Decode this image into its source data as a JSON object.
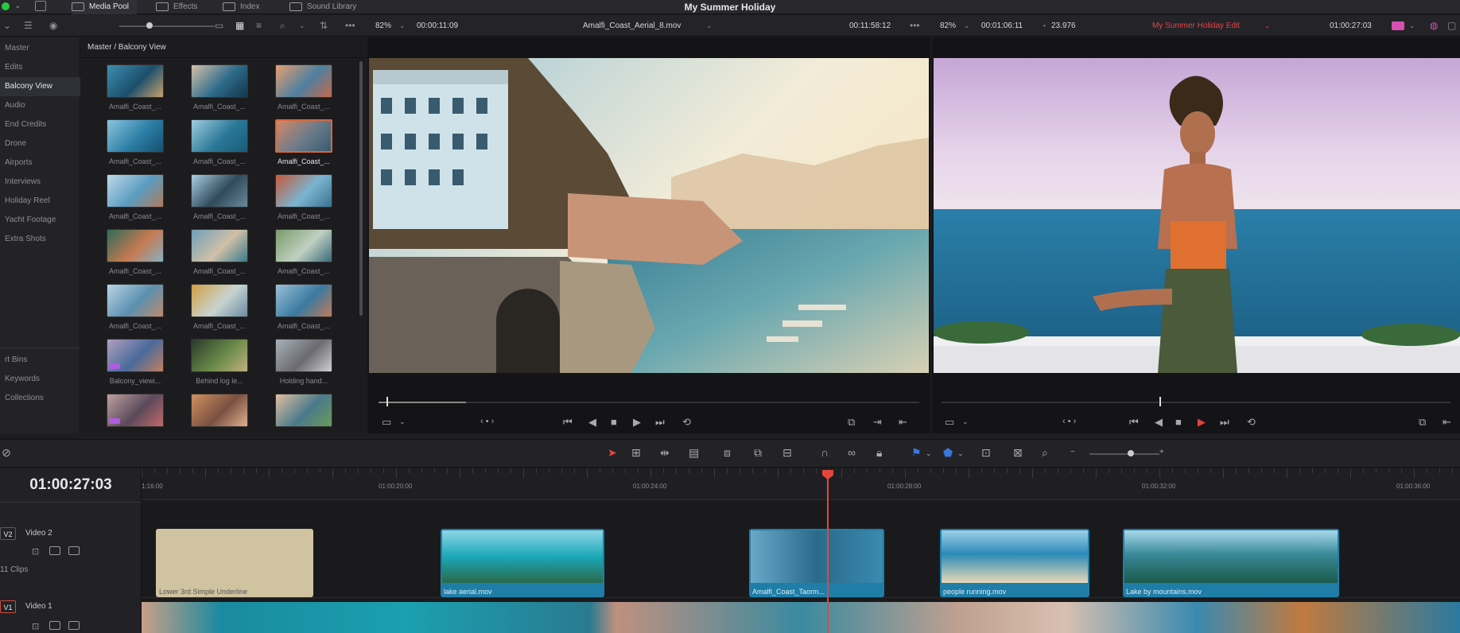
{
  "topbar": {
    "project_title": "My Summer Holiday",
    "tabs": [
      {
        "label": "Media Pool",
        "icon": "media-pool-icon",
        "active": true
      },
      {
        "label": "Effects",
        "icon": "effects-icon",
        "active": false
      },
      {
        "label": "Index",
        "icon": "index-icon",
        "active": false
      },
      {
        "label": "Sound Library",
        "icon": "sound-library-icon",
        "active": false
      }
    ]
  },
  "source_viewer": {
    "zoom": "82%",
    "timecode_in": "00:00:11:09",
    "clip_name": "Amalfi_Coast_Aerial_8.mov",
    "timecode_out": "00:11:58:12"
  },
  "timeline_viewer": {
    "zoom": "82%",
    "duration": "00:01:06:11",
    "fps": "23.976",
    "timeline_name": "My Summer Holiday Edit",
    "timecode": "01:00:27:03"
  },
  "sidebar": {
    "items": [
      "Master",
      "Edits",
      "Balcony View",
      "Audio",
      "End Credits",
      "Drone",
      "Airports",
      "Interviews",
      "Holiday Reel",
      "Yacht Footage",
      "Extra Shots"
    ],
    "selected": "Balcony View",
    "smart_bins_label": "rt Bins",
    "smart_items": [
      "Keywords",
      "Collections"
    ]
  },
  "media_pool": {
    "path": "Master / Balcony View",
    "clips": [
      {
        "label": "Amalfi_Coast_...",
        "colors": [
          "#3f8eb0",
          "#1b4f6a",
          "#c8a070"
        ]
      },
      {
        "label": "Amalfi_Coast_...",
        "colors": [
          "#d4c2a8",
          "#2e6c8a",
          "#14344c"
        ]
      },
      {
        "label": "Amalfi_Coast_...",
        "colors": [
          "#e6a070",
          "#4f7fa0",
          "#c46a4a"
        ]
      },
      {
        "label": "Amalfi_Coast_...",
        "colors": [
          "#8ac6e0",
          "#2d7ea6",
          "#145070"
        ]
      },
      {
        "label": "Amalfi_Coast_...",
        "colors": [
          "#9fcde0",
          "#2b7898",
          "#1a5a78"
        ]
      },
      {
        "label": "Amalfi_Coast_...",
        "colors": [
          "#d08a66",
          "#6a7b8a",
          "#3a5a70"
        ],
        "selected": true
      },
      {
        "label": "Amalfi_Coast_...",
        "colors": [
          "#bfd9ea",
          "#5b9cc0",
          "#b07a5a"
        ]
      },
      {
        "label": "Amalfi_Coast_...",
        "colors": [
          "#a7cfe2",
          "#304a5a",
          "#6a8a9c"
        ]
      },
      {
        "label": "Amalfi_Coast_...",
        "colors": [
          "#c45a3a",
          "#7ab4d0",
          "#3a7090"
        ]
      },
      {
        "label": "Amalfi_Coast_...",
        "colors": [
          "#2f6a58",
          "#c47a50",
          "#8ab0c0"
        ]
      },
      {
        "label": "Amalfi_Coast_...",
        "colors": [
          "#6ea0b8",
          "#d0c0a8",
          "#3a7a8a"
        ]
      },
      {
        "label": "Amalfi_Coast_...",
        "colors": [
          "#7a9a6a",
          "#c0d0c0",
          "#3a6a7a"
        ]
      },
      {
        "label": "Amalfi_Coast_...",
        "colors": [
          "#bcd4e6",
          "#5a90b0",
          "#c08a6a"
        ]
      },
      {
        "label": "Amalfi_Coast_...",
        "colors": [
          "#d0a040",
          "#c8d4d0",
          "#6a8aa0"
        ]
      },
      {
        "label": "Amalfi_Coast_...",
        "colors": [
          "#9ac0d8",
          "#3a7aa0",
          "#c07a5a"
        ]
      },
      {
        "label": "Balcony_viewi...",
        "colors": [
          "#b0a0c0",
          "#4a6a9a",
          "#c08060"
        ],
        "badge": true
      },
      {
        "label": "Behind log le...",
        "colors": [
          "#2a3a2a",
          "#6a8a4a",
          "#c0b080"
        ]
      },
      {
        "label": "Holding hand...",
        "colors": [
          "#a8b0b8",
          "#6a6a70",
          "#d0d0d4"
        ]
      },
      {
        "label": "",
        "colors": [
          "#c0a0a0",
          "#5a4a5a",
          "#c06a6a"
        ],
        "badge": true
      },
      {
        "label": "",
        "colors": [
          "#d09060",
          "#7a5040",
          "#e0b090"
        ]
      },
      {
        "label": "",
        "colors": [
          "#e0c0a0",
          "#4a7a8a",
          "#6a9a5a"
        ]
      }
    ]
  },
  "timeline": {
    "timecode": "01:00:27:03",
    "ruler_labels": [
      "1:16:00",
      "01:00:20:00",
      "01:00:24:00",
      "01:00:28:00",
      "01:00:32:00",
      "01:00:36:00"
    ],
    "tracks": [
      {
        "id": "V2",
        "name": "Video 2",
        "clip_count": "11 Clips"
      },
      {
        "id": "V1",
        "name": "Video 1"
      }
    ],
    "v2_clips": [
      {
        "name": "Lower 3rd Simple Underline",
        "kind": "title",
        "color": "#cfc3a0"
      },
      {
        "name": "lake aerial.mov",
        "kind": "video",
        "color": "#1f7ea8"
      },
      {
        "name": "Amalfi_Coast_Taorm...",
        "kind": "video",
        "color": "#1f7ea8"
      },
      {
        "name": "people running.mov",
        "kind": "video",
        "color": "#1f7ea8"
      },
      {
        "name": "Lake by mountains.mov",
        "kind": "video",
        "color": "#1f7ea8"
      }
    ]
  }
}
